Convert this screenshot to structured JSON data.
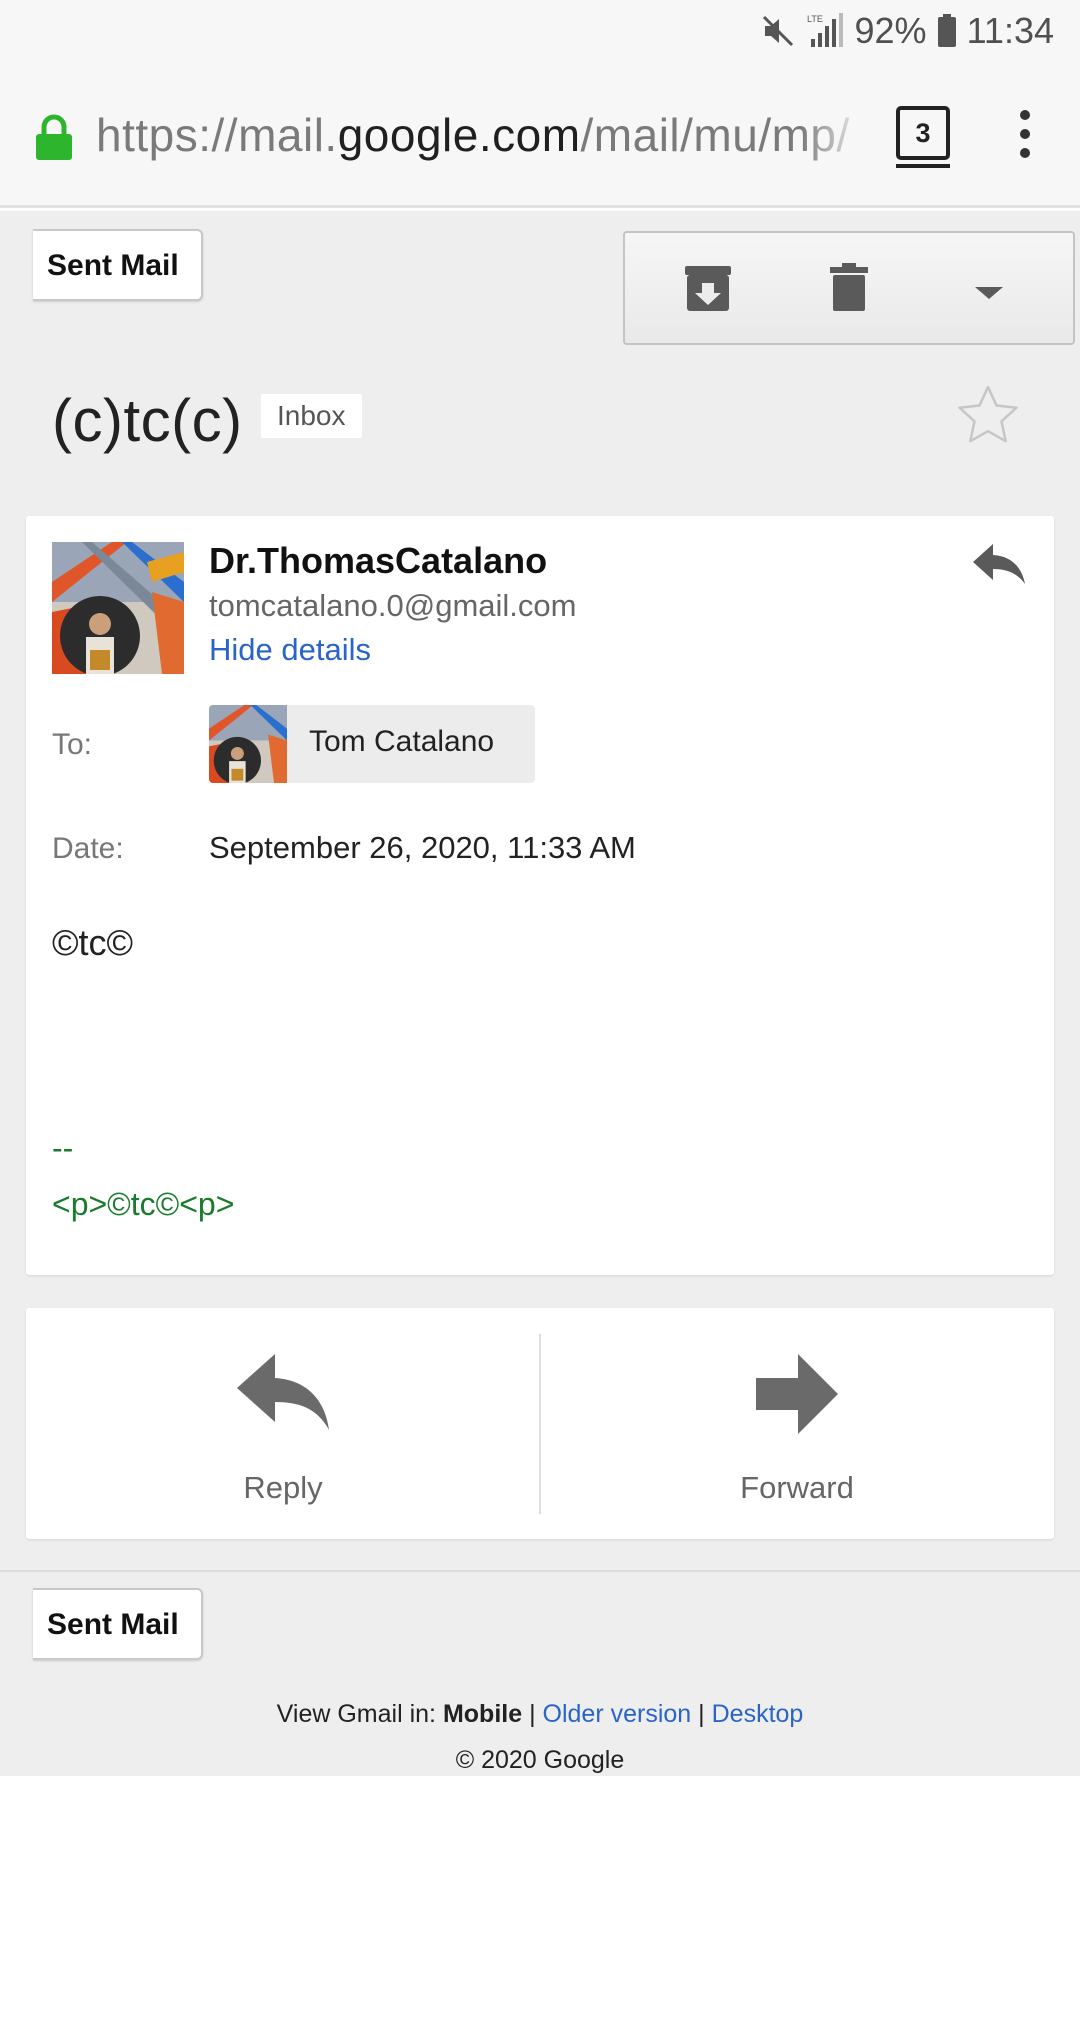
{
  "status_bar": {
    "network": "LTE",
    "battery": "92%",
    "time": "11:34"
  },
  "browser": {
    "url_prefix": "https://mail.",
    "url_domain": "google.com",
    "url_suffix": "/mail/mu/mp/",
    "tab_count": "3"
  },
  "nav": {
    "back_label": "Sent Mail"
  },
  "toolbar": {
    "icons": [
      "archive-icon",
      "trash-icon",
      "dropdown-caret-icon"
    ]
  },
  "thread": {
    "subject": "(c)tc(c)",
    "label": "Inbox",
    "starred": false
  },
  "message": {
    "sender_name": "Dr.ThomasCatalano",
    "sender_email": "tomcatalano.0@gmail.com",
    "hide_details": "Hide details",
    "to_label": "To:",
    "to_name": "Tom Catalano",
    "date_label": "Date:",
    "date_value": "September 26, 2020, 11:33 AM",
    "body": "©tc©",
    "sig_dash": "--",
    "sig_text": "<p>©tc©<p>"
  },
  "actions": {
    "reply": "Reply",
    "forward": "Forward"
  },
  "footer": {
    "view_prefix": "View Gmail in:",
    "mobile": "Mobile",
    "sep": "|",
    "older": "Older version",
    "desktop": "Desktop",
    "copyright": "© 2020 Google"
  },
  "colors": {
    "link": "#2a64c9",
    "signature": "#1a7a2e",
    "lock": "#2db52d"
  }
}
